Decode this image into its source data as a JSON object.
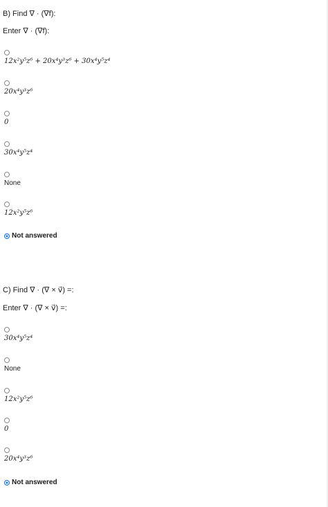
{
  "questionB": {
    "title": "B) Find ∇ · (∇f):",
    "enter": "Enter ∇ · (∇f):",
    "options": [
      "12x²y⁵z⁶ + 20x⁴y³z⁶ + 30x⁴y⁵z⁴",
      "20x⁴y³z⁶",
      "0",
      "30x⁴y⁵z⁴",
      "None",
      "12x²y⁵z⁶"
    ],
    "not_answered": "Not answered"
  },
  "questionC": {
    "title": "C) Find ∇ · (∇ × v⃗) =:",
    "enter": "Enter ∇ · (∇ × v⃗) =:",
    "options": [
      "30x⁴y⁵z⁴",
      "None",
      "12x²y⁵z⁶",
      "0",
      "20x⁴y³z⁶"
    ],
    "not_answered": "Not answered"
  }
}
